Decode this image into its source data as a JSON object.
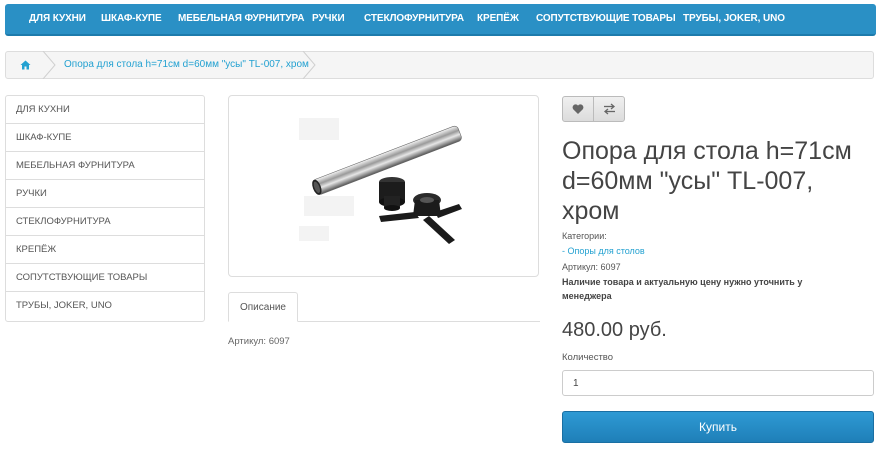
{
  "nav": {
    "items": [
      "ДЛЯ КУХНИ",
      "ШКАФ-КУПЕ",
      "МЕБЕЛЬНАЯ ФУРНИТУРА",
      "РУЧКИ",
      "СТЕКЛОФУРНИТУРА",
      "КРЕПЁЖ",
      "СОПУТСТВУЮЩИЕ ТОВАРЫ",
      "ТРУБЫ, JOKER, UNO"
    ]
  },
  "breadcrumb": {
    "home_icon": "home-icon",
    "current": "Опора для стола h=71см d=60мм \"усы\" TL-007, хром"
  },
  "sidebar": {
    "items": [
      "ДЛЯ КУХНИ",
      "ШКАФ-КУПЕ",
      "МЕБЕЛЬНАЯ ФУРНИТУРА",
      "РУЧКИ",
      "СТЕКЛОФУРНИТУРА",
      "КРЕПЁЖ",
      "СОПУТСТВУЮЩИЕ ТОВАРЫ",
      "ТРУБЫ, JOKER, UNO"
    ]
  },
  "tabs": {
    "description": "Описание"
  },
  "description": {
    "article": "Артикул: 6097"
  },
  "product": {
    "title": "Опора для стола h=71см d=60мм \"усы\" TL-007, хром",
    "categories_label": "Категории:",
    "category_link": "- Опоры для столов",
    "article": "Артикул: 6097",
    "notice": "Наличие товара и актуальную цену нужно уточнить у менеджера",
    "price": "480.00 руб.",
    "qty_label": "Количество",
    "qty_value": "1",
    "buy_label": "Купить",
    "wishlist_icon": "heart-icon",
    "compare_icon": "exchange-icon"
  },
  "colors": {
    "nav_bg": "#2a90c5",
    "link": "#23a1d1",
    "button": "#2e9ad4"
  }
}
